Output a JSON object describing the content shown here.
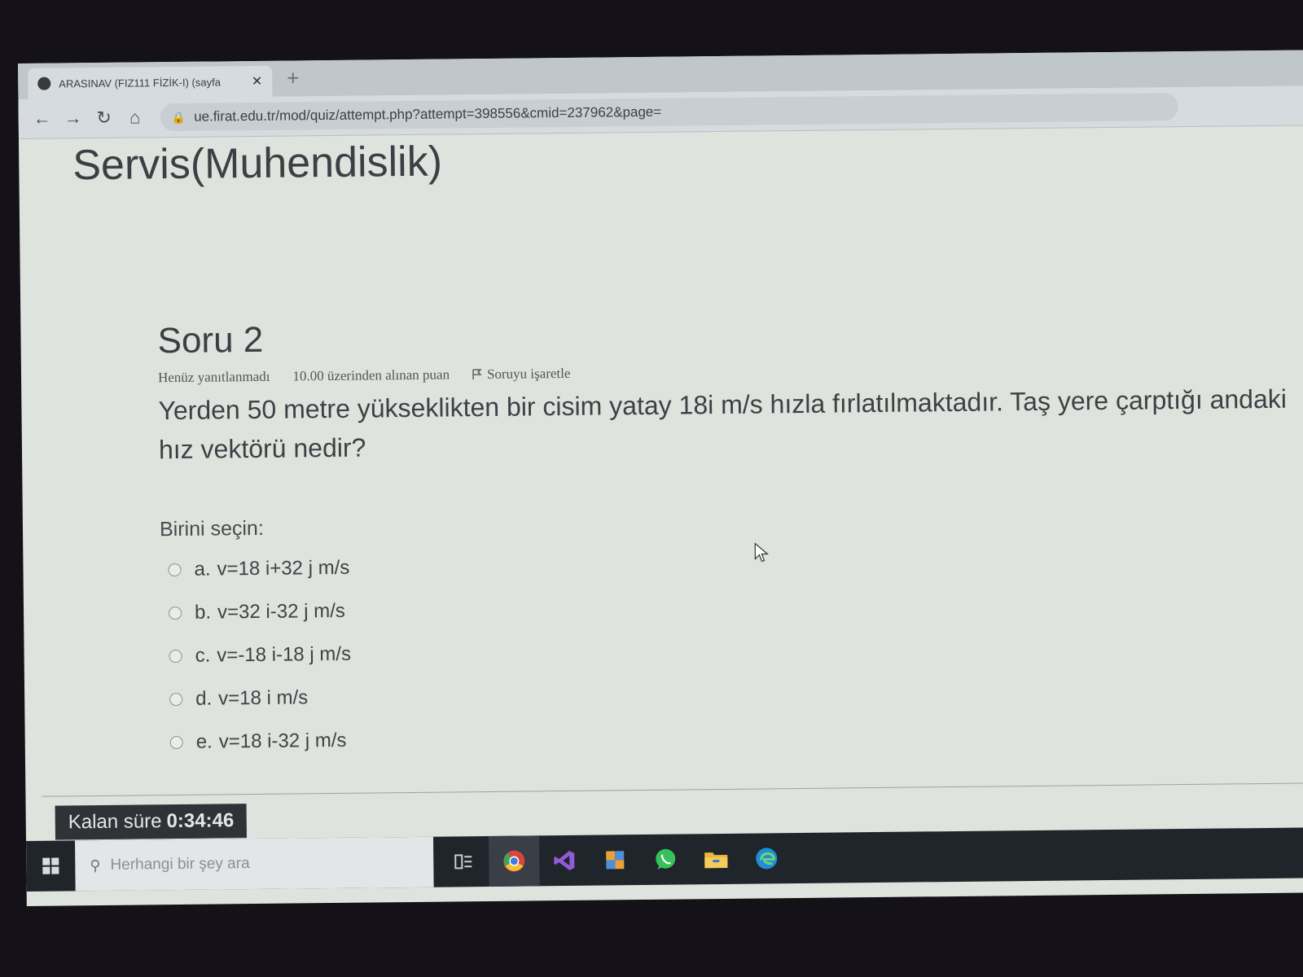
{
  "browser": {
    "tab_title": "ARASINAV (FIZ111 FİZİK-I) (sayfa",
    "url": "ue.firat.edu.tr/mod/quiz/attempt.php?attempt=398556&cmid=237962&page="
  },
  "page": {
    "heading": "Servis(Muhendislik)"
  },
  "question": {
    "title": "Soru 2",
    "status": "Henüz yanıtlanmadı",
    "points": "10.00 üzerinden alınan puan",
    "flag_label": "Soruyu işaretle",
    "text": "Yerden 50 metre yükseklikten bir cisim yatay 18i m/s hızla fırlatılmaktadır. Taş yere çarptığı andaki hız vektörü nedir?",
    "prompt": "Birini seçin:",
    "options": [
      {
        "letter": "a.",
        "text": "v=18 i+32 j m/s"
      },
      {
        "letter": "b.",
        "text": "v=32 i-32 j m/s"
      },
      {
        "letter": "c.",
        "text": "v=-18 i-18 j m/s"
      },
      {
        "letter": "d.",
        "text": "v=18 i m/s"
      },
      {
        "letter": "e.",
        "text": "v=18 i-32 j m/s"
      }
    ]
  },
  "timer": {
    "label": "Kalan süre",
    "value": "0:34:46"
  },
  "taskbar": {
    "search_placeholder": "Herhangi bir şey ara",
    "icons": [
      "task-view-icon",
      "chrome-icon",
      "visual-studio-icon",
      "app-icon",
      "whatsapp-icon",
      "file-explorer-icon",
      "edge-icon"
    ]
  }
}
